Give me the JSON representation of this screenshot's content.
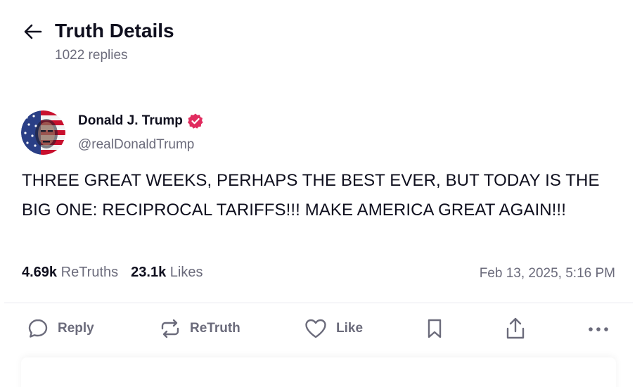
{
  "header": {
    "title": "Truth Details",
    "replies": "1022 replies"
  },
  "post": {
    "author": {
      "name": "Donald J. Trump",
      "handle": "@realDonaldTrump",
      "verified": true
    },
    "text": "THREE GREAT WEEKS, PERHAPS THE BEST EVER, BUT TODAY IS THE BIG ONE: RECIPROCAL TARIFFS!!! MAKE AMERICA GREAT AGAIN!!!",
    "stats": {
      "retruths_count": "4.69k",
      "retruths_label": "ReTruths",
      "likes_count": "23.1k",
      "likes_label": "Likes"
    },
    "timestamp": "Feb 13, 2025, 5:16 PM"
  },
  "actions": {
    "reply": "Reply",
    "retruth": "ReTruth",
    "like": "Like"
  },
  "icons": {
    "back": "arrow-left-icon",
    "verified": "verified-badge-icon",
    "reply": "speech-bubble-icon",
    "retruth": "repost-arrows-icon",
    "like": "heart-icon",
    "bookmark": "bookmark-icon",
    "share": "share-upload-icon",
    "more": "more-dots-icon"
  },
  "colors": {
    "accent": "#e12c5f",
    "text_primary": "#0f0f1e",
    "text_secondary": "#6b6b7b",
    "divider": "#e8e8ee"
  }
}
